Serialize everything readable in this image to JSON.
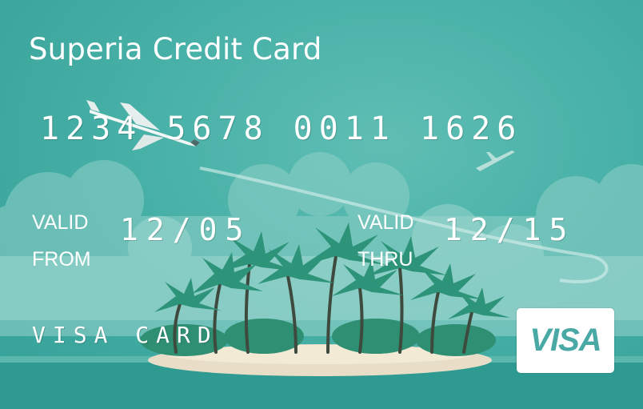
{
  "card": {
    "title": "Superia Credit Card",
    "number_groups": [
      "1234",
      "5678",
      "0011",
      "1626"
    ],
    "valid_from_label": [
      "VALID",
      "FROM"
    ],
    "valid_from": "12/05",
    "valid_thru_label": [
      "VALID",
      "THRU"
    ],
    "valid_thru": "12/15",
    "network_name": "VISA CARD",
    "logo_text": "VISA"
  },
  "colors": {
    "background": "#47b0a7",
    "text": "#ffffff",
    "logo_text": "#4aa9a5"
  },
  "icons": [
    "airplane-icon",
    "palm-tree-icon",
    "island-icon",
    "cloud-icon"
  ]
}
